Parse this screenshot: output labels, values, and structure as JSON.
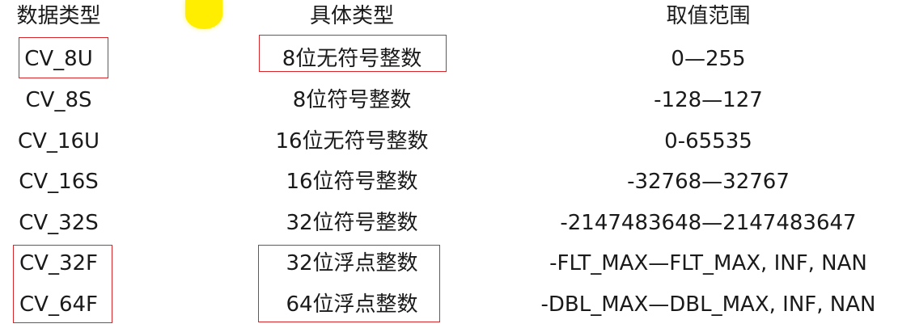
{
  "headers": [
    "数据类型",
    "具体类型",
    "取值范围"
  ],
  "rows": [
    {
      "type": "CV_8U",
      "desc": "8位无符号整数",
      "range": "0—255"
    },
    {
      "type": "CV_8S",
      "desc": "8位符号整数",
      "range": "-128—127"
    },
    {
      "type": "CV_16U",
      "desc": "16位无符号整数",
      "range": "0-65535"
    },
    {
      "type": "CV_16S",
      "desc": "16位符号整数",
      "range": "-32768—32767"
    },
    {
      "type": "CV_32S",
      "desc": "32位符号整数",
      "range": "-2147483648—2147483647"
    },
    {
      "type": "CV_32F",
      "desc": "32位浮点整数",
      "range": "-FLT_MAX—FLT_MAX, INF, NAN"
    },
    {
      "type": "CV_64F",
      "desc": "64位浮点整数",
      "range": "-DBL_MAX—DBL_MAX, INF, NAN"
    }
  ],
  "colors": {
    "highlight_box": "#d9262b",
    "cursor": "#ffee00"
  }
}
